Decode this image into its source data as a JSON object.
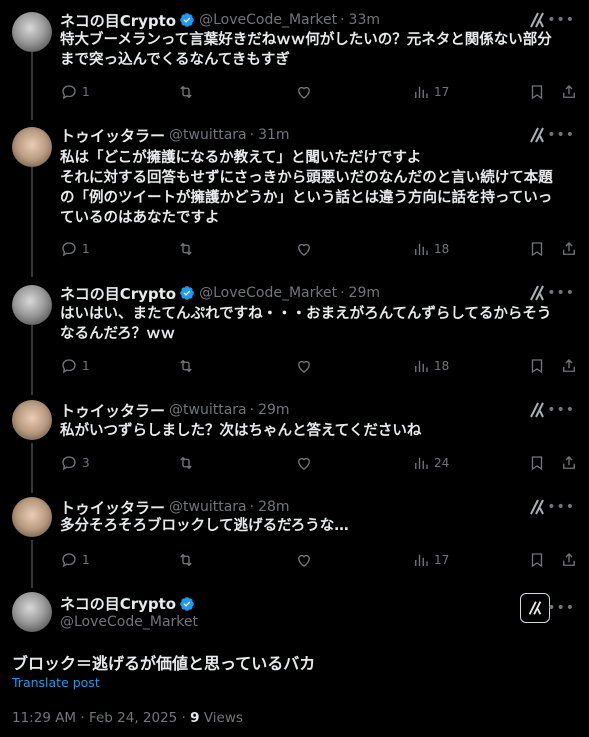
{
  "colors": {
    "background": "#000000",
    "text": "#e7e9ea",
    "muted": "#71767b",
    "link": "#1d9bf0",
    "verified": "#1d9bf0",
    "line": "#333639"
  },
  "tweets": [
    {
      "name": "ネコの目Crypto",
      "verified": true,
      "handle": "@LoveCode_Market",
      "sep": "·",
      "time": "33m",
      "lines": [
        "特大ブーメランって言葉好きだねｗｗ何がしたいの？元ネタと関係ない部分",
        "まで突っ込んでくるなんてきもすぎ"
      ],
      "replies": "1",
      "views": "17",
      "avatar_icon": "cat-avatar"
    },
    {
      "name": "トゥイッタラー",
      "verified": false,
      "handle": "@twuittara",
      "sep": "·",
      "time": "31m",
      "lines": [
        "私は「どこが擁護になるか教えて」と聞いただけですよ",
        "それに対する回答もせずにさっきから頭悪いだのなんだのと言い続けて本題",
        "の「例のツイートが擁護かどうか」という話とは違う方向に話を持っていっ",
        "ているのはあなたですよ"
      ],
      "replies": "1",
      "views": "18",
      "avatar_icon": "girl-avatar"
    },
    {
      "name": "ネコの目Crypto",
      "verified": true,
      "handle": "@LoveCode_Market",
      "sep": "·",
      "time": "29m",
      "lines": [
        "はいはい、またてんぷれですね・・・おまえがろんてんずらしてるからそう",
        "なるんだろ？ｗｗ"
      ],
      "replies": "1",
      "views": "18",
      "avatar_icon": "cat-avatar"
    },
    {
      "name": "トゥイッタラー",
      "verified": false,
      "handle": "@twuittara",
      "sep": "·",
      "time": "29m",
      "lines": [
        "私がいつずらしました？次はちゃんと答えてくださいね"
      ],
      "replies": "3",
      "views": "24",
      "avatar_icon": "girl-avatar"
    },
    {
      "name": "トゥイッタラー",
      "verified": false,
      "handle": "@twuittara",
      "sep": "·",
      "time": "28m",
      "lines": [
        "多分そろそろブロックして逃げるだろうな…"
      ],
      "replies": "1",
      "views": "17",
      "avatar_icon": "girl-avatar"
    }
  ],
  "main": {
    "name": "ネコの目Crypto",
    "handle": "@LoveCode_Market",
    "text": "ブロック＝逃げるが価値と思っているバカ",
    "translate": "Translate post",
    "time": "11:29 AM · Feb 24, 2025 · ",
    "views_count": "9",
    "views_label": " Views"
  }
}
